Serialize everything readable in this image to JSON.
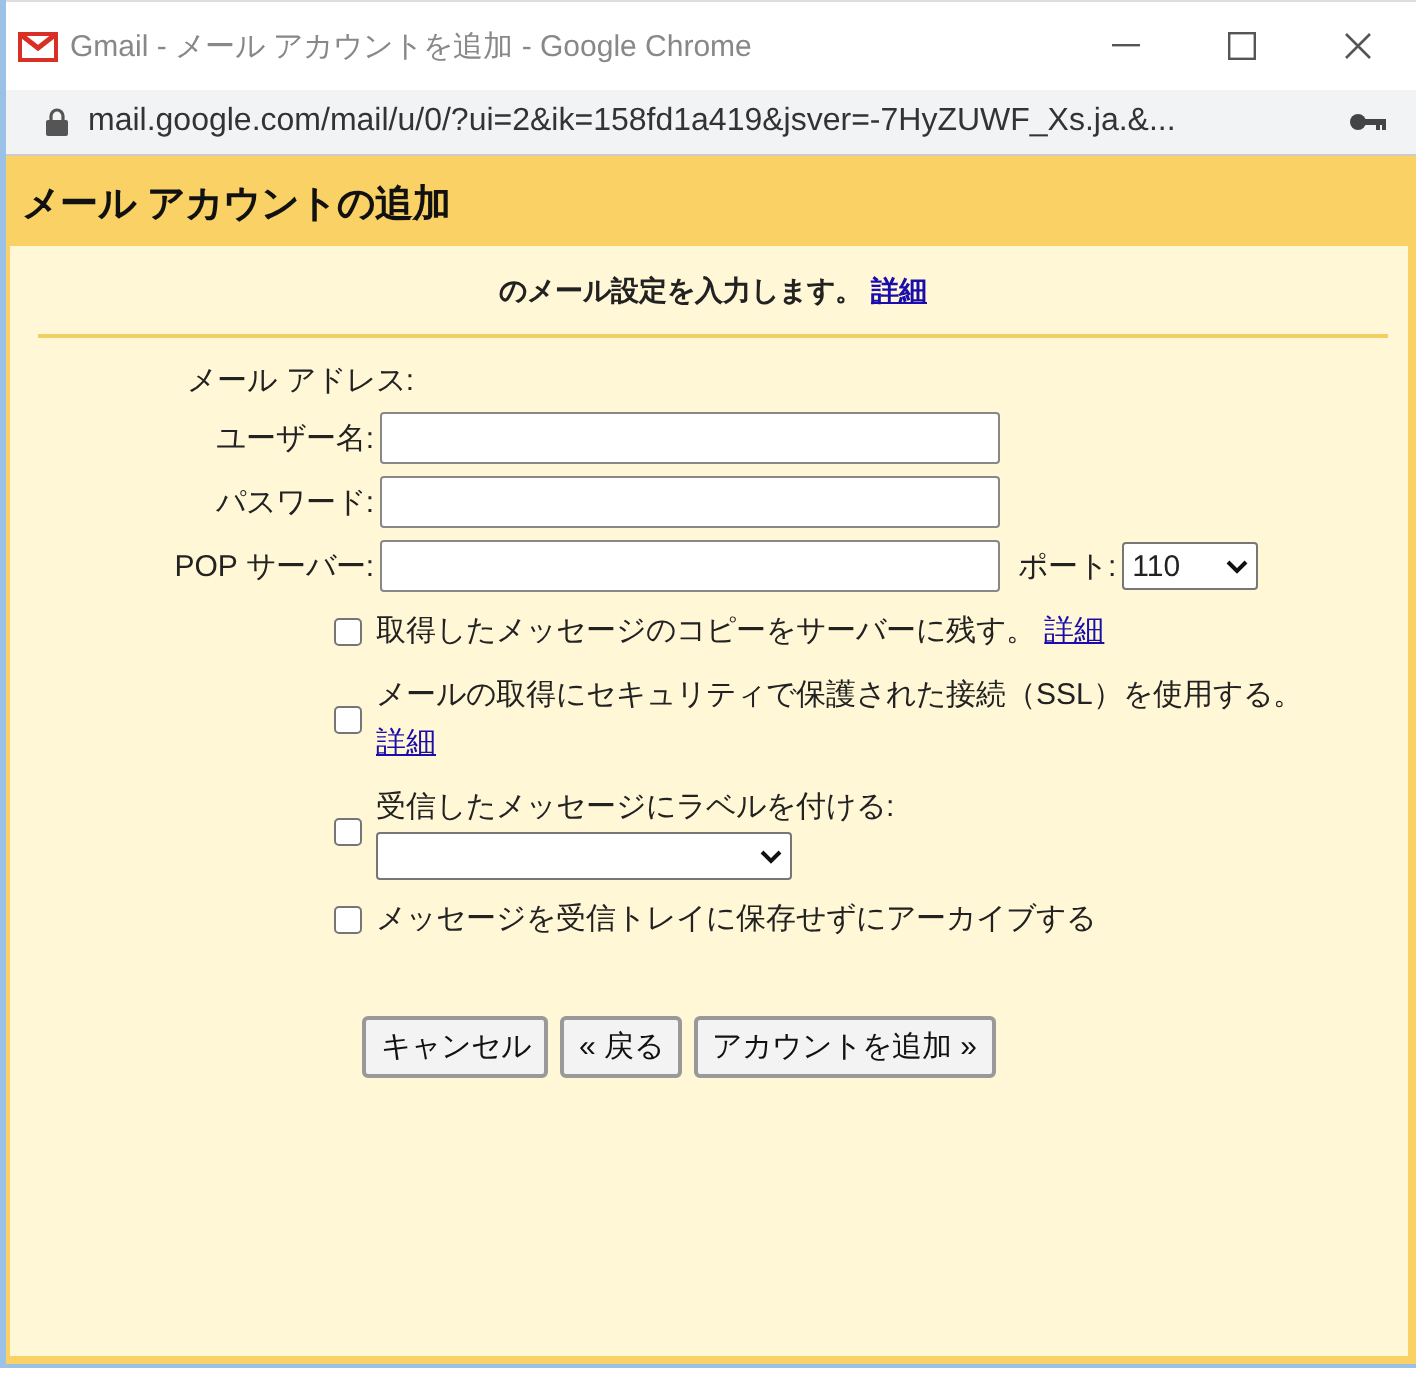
{
  "browser": {
    "title": "Gmail - メール アカウントを追加 - Google Chrome",
    "url": "mail.google.com/mail/u/0/?ui=2&ik=158fd1a419&jsver=-7HyZUWF_Xs.ja.&..."
  },
  "dialog": {
    "title": "メール アカウントの追加",
    "intro": {
      "text": "のメール設定を入力します。",
      "link": "詳細"
    },
    "email_label": "メール アドレス:",
    "fields": [
      {
        "label": "ユーザー名:"
      },
      {
        "label": "パスワード:"
      },
      {
        "label": "POP サーバー:"
      }
    ],
    "port": {
      "label": "ポート:",
      "value": "110"
    },
    "options": [
      {
        "kind": "plain",
        "text": "取得したメッセージのコピーをサーバーに残す。",
        "link": "詳細",
        "checked": false
      },
      {
        "kind": "plain",
        "text": "メールの取得にセキュリティで保護された接続（SSL）を使用する。",
        "link": "詳細",
        "checked": false
      },
      {
        "kind": "label-select",
        "text": "受信したメッセージにラベルを付ける:",
        "checked": false
      },
      {
        "kind": "plain",
        "text": "メッセージを受信トレイに保存せずにアーカイブする",
        "checked": false
      }
    ],
    "buttons": [
      {
        "label": "キャンセル"
      },
      {
        "label": "« 戻る"
      },
      {
        "label": "アカウントを追加 »"
      }
    ]
  }
}
